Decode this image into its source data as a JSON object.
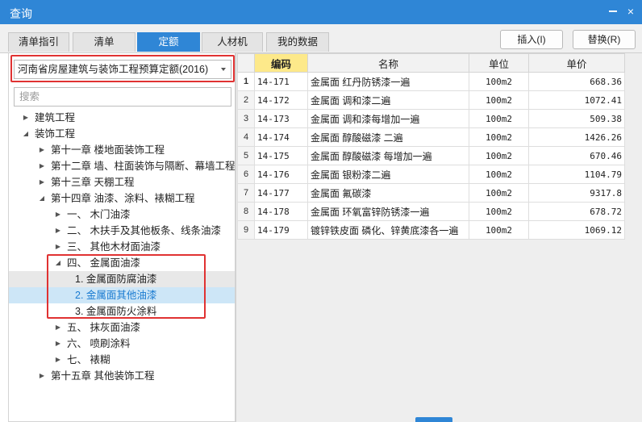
{
  "window": {
    "title": "查询",
    "minimize_glyph": "",
    "close_glyph": "×"
  },
  "tabs": [
    {
      "label": "清单指引",
      "active": false
    },
    {
      "label": "清单",
      "active": false
    },
    {
      "label": "定额",
      "active": true
    },
    {
      "label": "人材机",
      "active": false
    },
    {
      "label": "我的数据",
      "active": false
    }
  ],
  "toolbar": {
    "insert_label": "插入(I)",
    "replace_label": "替换(R)"
  },
  "left": {
    "quota_select": "河南省房屋建筑与装饰工程预算定额(2016)",
    "search_placeholder": "搜索",
    "tree": [
      {
        "label": "建筑工程",
        "depth": 0,
        "state": "collapsed"
      },
      {
        "label": "装饰工程",
        "depth": 0,
        "state": "expanded"
      },
      {
        "label": "第十一章 楼地面装饰工程",
        "depth": 1,
        "state": "collapsed"
      },
      {
        "label": "第十二章 墙、柱面装饰与隔断、幕墙工程",
        "depth": 1,
        "state": "collapsed"
      },
      {
        "label": "第十三章 天棚工程",
        "depth": 1,
        "state": "collapsed"
      },
      {
        "label": "第十四章 油漆、涂料、裱糊工程",
        "depth": 1,
        "state": "expanded"
      },
      {
        "label": "一、 木门油漆",
        "depth": 2,
        "state": "collapsed"
      },
      {
        "label": "二、 木扶手及其他板条、线条油漆",
        "depth": 2,
        "state": "collapsed"
      },
      {
        "label": "三、 其他木材面油漆",
        "depth": 2,
        "state": "collapsed"
      },
      {
        "label": "四、 金属面油漆",
        "depth": 2,
        "state": "expanded"
      },
      {
        "label": "1. 金属面防腐油漆",
        "depth": 3,
        "state": "leaf",
        "highlight": "gray"
      },
      {
        "label": "2. 金属面其他油漆",
        "depth": 3,
        "state": "leaf",
        "highlight": "blue"
      },
      {
        "label": "3. 金属面防火涂料",
        "depth": 3,
        "state": "leaf"
      },
      {
        "label": "五、 抹灰面油漆",
        "depth": 2,
        "state": "collapsed"
      },
      {
        "label": "六、 喷刷涂料",
        "depth": 2,
        "state": "collapsed"
      },
      {
        "label": "七、 裱糊",
        "depth": 2,
        "state": "collapsed"
      },
      {
        "label": "第十五章 其他装饰工程",
        "depth": 1,
        "state": "collapsed"
      }
    ]
  },
  "grid": {
    "headers": {
      "row_no": "",
      "code": "编码",
      "name": "名称",
      "unit": "单位",
      "price": "单价"
    },
    "rows": [
      {
        "no": "1",
        "code": "14-171",
        "name": "金属面 红丹防锈漆一遍",
        "unit": "100m2",
        "price": "668.36"
      },
      {
        "no": "2",
        "code": "14-172",
        "name": "金属面 调和漆二遍",
        "unit": "100m2",
        "price": "1072.41"
      },
      {
        "no": "3",
        "code": "14-173",
        "name": "金属面 调和漆每增加一遍",
        "unit": "100m2",
        "price": "509.38"
      },
      {
        "no": "4",
        "code": "14-174",
        "name": "金属面 醇酸磁漆 二遍",
        "unit": "100m2",
        "price": "1426.26"
      },
      {
        "no": "5",
        "code": "14-175",
        "name": "金属面 醇酸磁漆 每增加一遍",
        "unit": "100m2",
        "price": "670.46"
      },
      {
        "no": "6",
        "code": "14-176",
        "name": "金属面 银粉漆二遍",
        "unit": "100m2",
        "price": "1104.79"
      },
      {
        "no": "7",
        "code": "14-177",
        "name": "金属面 氟碳漆",
        "unit": "100m2",
        "price": "9317.8"
      },
      {
        "no": "8",
        "code": "14-178",
        "name": "金属面 环氧富锌防锈漆一遍",
        "unit": "100m2",
        "price": "678.72"
      },
      {
        "no": "9",
        "code": "14-179",
        "name": "镀锌铁皮面 磷化、锌黄底漆各一遍",
        "unit": "100m2",
        "price": "1069.12"
      }
    ]
  },
  "colors": {
    "accent": "#2f86d6",
    "highlight_box": "#e03232",
    "code_header": "#fde98a",
    "selected_row": "#cde6f7"
  }
}
